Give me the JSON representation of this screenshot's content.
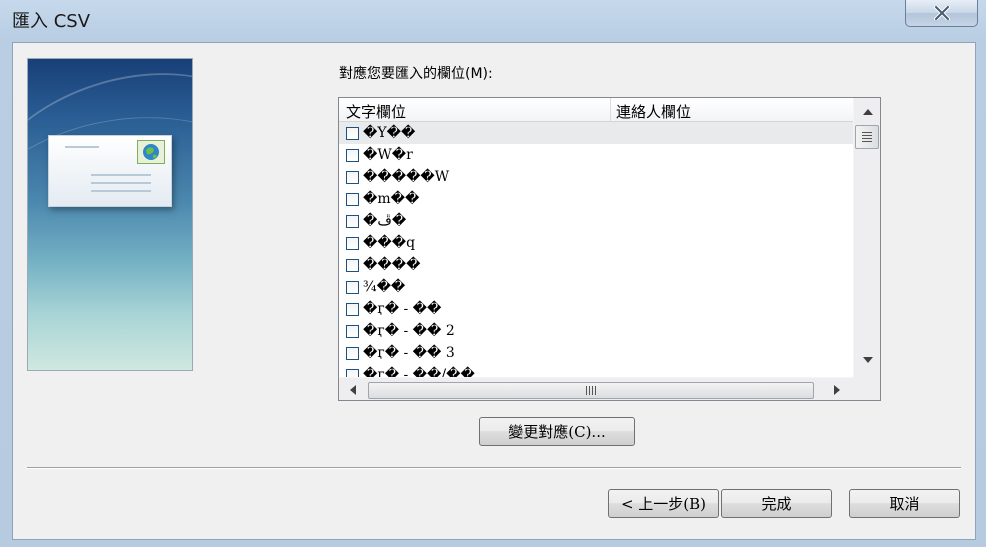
{
  "window": {
    "title": "匯入 CSV"
  },
  "main": {
    "map_label": "對應您要匯入的欄位(M):",
    "columns": [
      "文字欄位",
      "連絡人欄位"
    ],
    "rows": [
      {
        "text": "�Y��",
        "selected": true
      },
      {
        "text": "�W�r",
        "selected": false
      },
      {
        "text": "�����W",
        "selected": false
      },
      {
        "text": "�m��",
        "selected": false
      },
      {
        "text": "�ڦ�",
        "selected": false
      },
      {
        "text": "���q",
        "selected": false
      },
      {
        "text": "����",
        "selected": false
      },
      {
        "text": "¾��",
        "selected": false
      },
      {
        "text": "�ӷ� - ��",
        "selected": false
      },
      {
        "text": "�ӷ� - �� 2",
        "selected": false
      },
      {
        "text": "�ӷ� - �� 3",
        "selected": false
      },
      {
        "text": "�ӷ� - ��/��",
        "selected": false
      }
    ],
    "change_map_button": "變更對應(C)..."
  },
  "footer": {
    "back_button": "< 上一步(B)",
    "finish_button": "完成",
    "cancel_button": "取消"
  },
  "icons": {
    "close": "close-icon",
    "scroll_up": "scroll-up-icon",
    "scroll_down": "scroll-down-icon",
    "scroll_left": "scroll-left-icon",
    "scroll_right": "scroll-right-icon"
  }
}
